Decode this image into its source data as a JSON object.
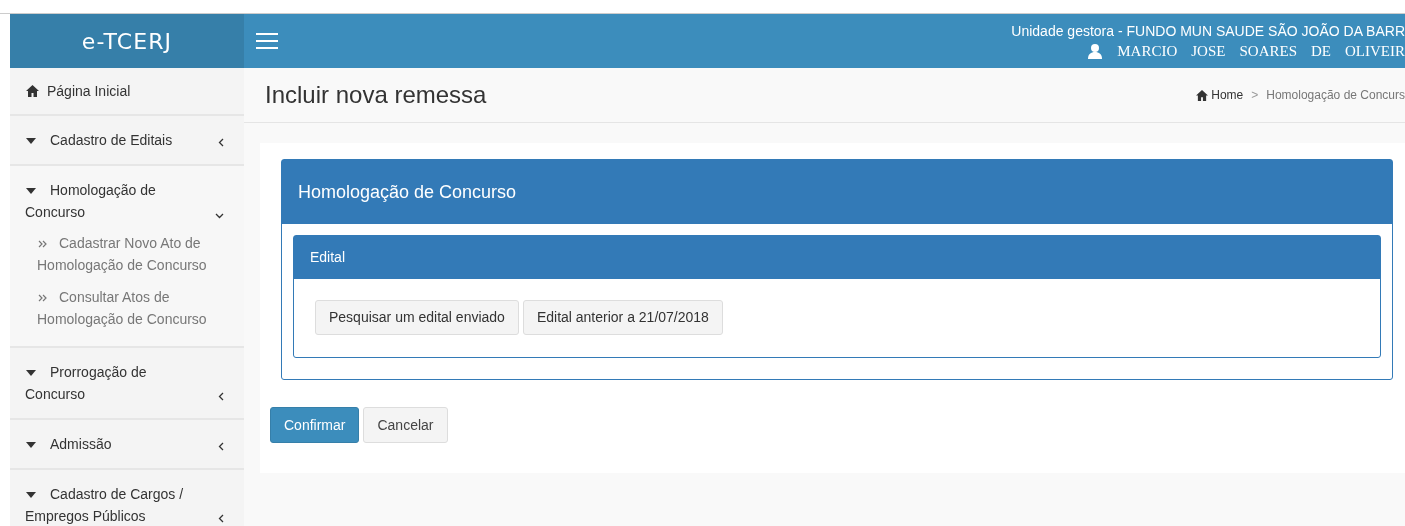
{
  "header": {
    "logo": "e-TCERJ",
    "unit": "Unidade gestora - FUNDO MUN SAUDE SÃO JOÃO DA BARR",
    "user": [
      "MARCIO",
      "JOSE",
      "SOARES",
      "DE",
      "OLIVEIR"
    ]
  },
  "sidebar": {
    "items": [
      {
        "kind": "home",
        "label": "Página Inicial"
      },
      {
        "kind": "menu",
        "label": "Cadastro de Editais",
        "expanded": false
      },
      {
        "kind": "menu",
        "label": "Homologação de Concurso",
        "expanded": true,
        "children": [
          {
            "label": "Cadastrar Novo Ato de Homologação de Concurso"
          },
          {
            "label": "Consultar Atos de Homologação de Concurso"
          }
        ]
      },
      {
        "kind": "menu",
        "label": "Prorrogação de Concurso",
        "expanded": false
      },
      {
        "kind": "menu",
        "label": "Admissão",
        "expanded": false
      },
      {
        "kind": "menu",
        "label": "Cadastro de Cargos / Empregos Públicos",
        "expanded": false
      }
    ]
  },
  "page": {
    "title": "Incluir nova remessa",
    "breadcrumb": [
      "Home",
      "Homologação de Concurs"
    ],
    "breadcrumb_separator": ">"
  },
  "panel": {
    "title": "Homologação de Concurso",
    "subpanel": {
      "title": "Edital",
      "buttons": [
        "Pesquisar um edital enviado",
        "Edital anterior a 21/07/2018"
      ]
    }
  },
  "actions": [
    {
      "label": "Confirmar",
      "kind": "primary"
    },
    {
      "label": "Cancelar",
      "kind": "default"
    }
  ]
}
